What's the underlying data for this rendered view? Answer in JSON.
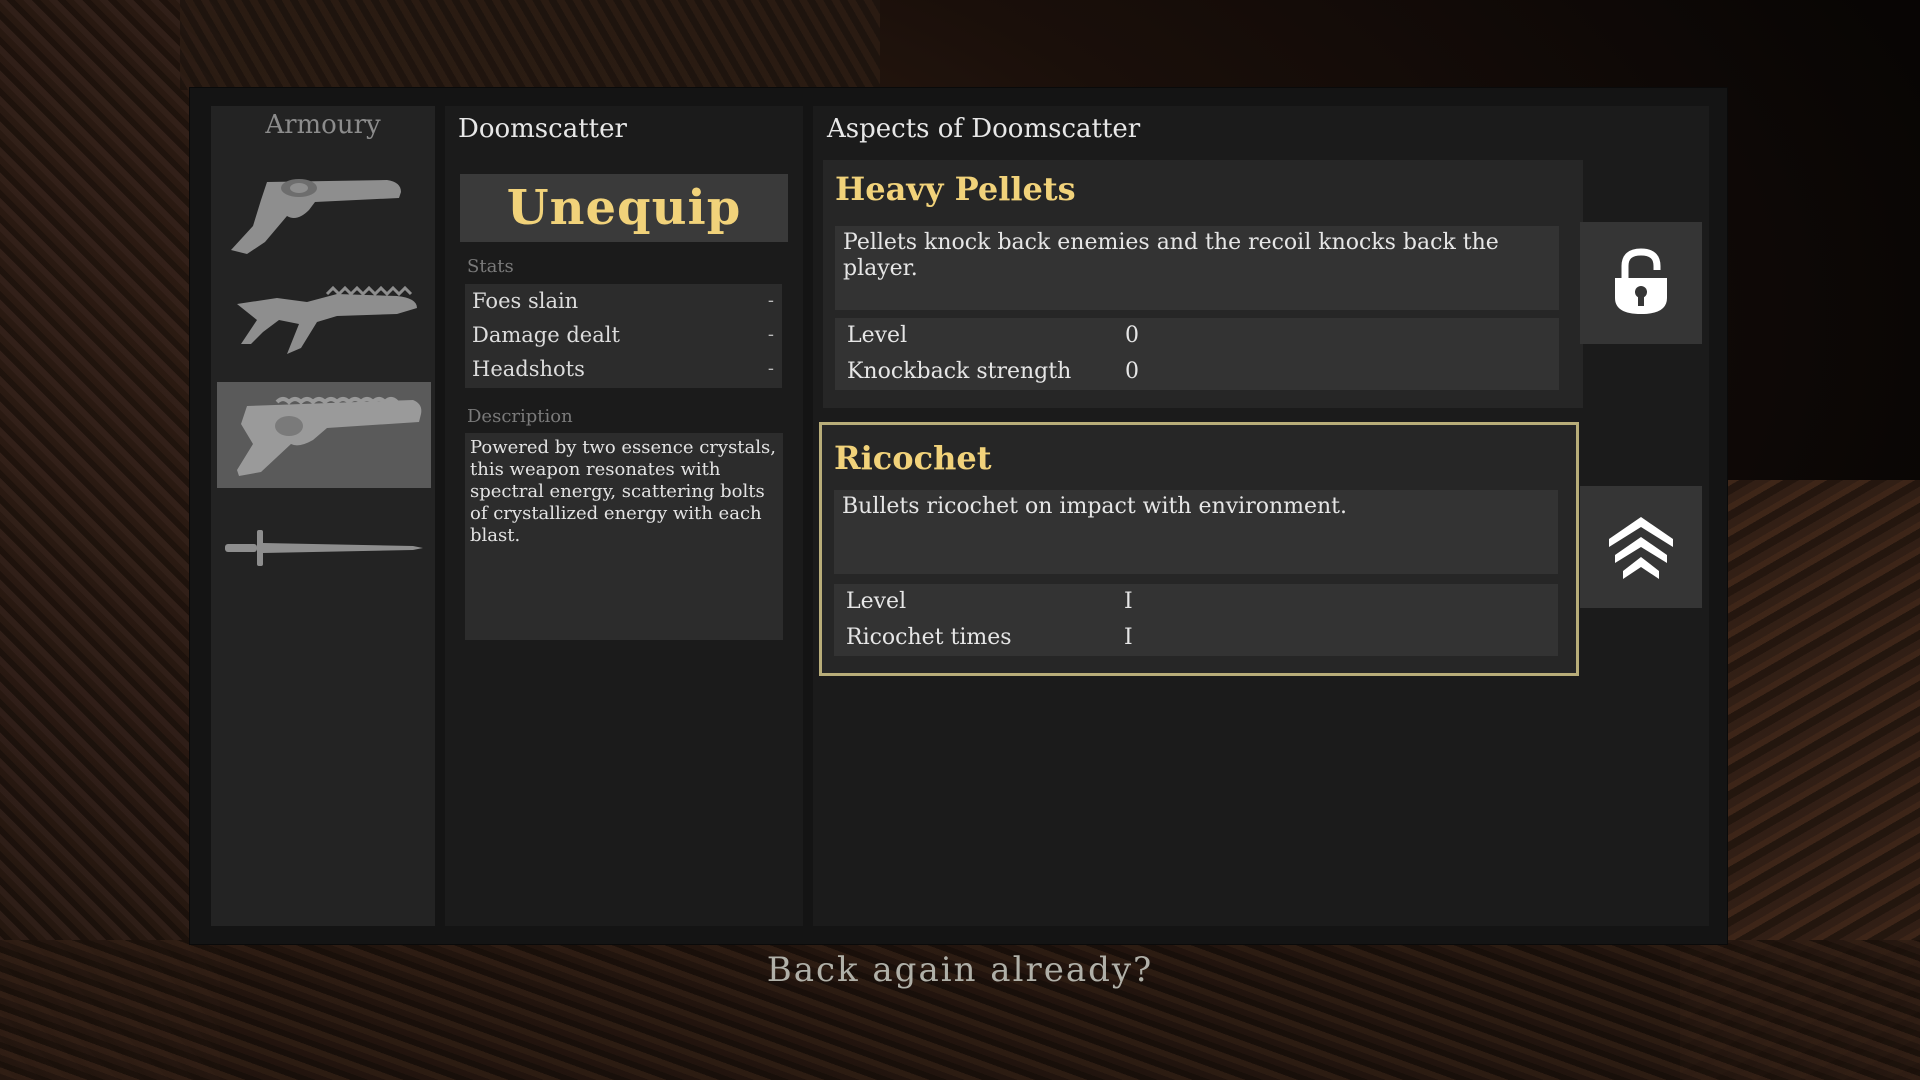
{
  "armoury": {
    "title": "Armoury",
    "weapons": [
      {
        "icon": "revolver-icon"
      },
      {
        "icon": "spiked-rifle-icon"
      },
      {
        "icon": "doomscatter-icon",
        "selected": true
      },
      {
        "icon": "sword-icon"
      }
    ]
  },
  "weapon": {
    "name": "Doomscatter",
    "unequip_label": "Unequip",
    "stats_label": "Stats",
    "stats": [
      {
        "label": "Foes slain",
        "value": "-"
      },
      {
        "label": "Damage dealt",
        "value": "-"
      },
      {
        "label": "Headshots",
        "value": "-"
      }
    ],
    "description_label": "Description",
    "description": "Powered by two essence crystals, this weapon resonates with spectral energy, scattering bolts of crystallized energy with each blast."
  },
  "aspects": {
    "title": "Aspects of Doomscatter",
    "items": [
      {
        "name": "Heavy Pellets",
        "description": "Pellets knock back enemies and the recoil knocks back the player.",
        "stats": [
          {
            "label": "Level",
            "value": "0"
          },
          {
            "label": "Knockback strength",
            "value": "0"
          }
        ],
        "action_icon": "unlock-icon"
      },
      {
        "name": "Ricochet",
        "description": "Bullets ricochet on impact with environment.",
        "stats": [
          {
            "label": "Level",
            "value": "I"
          },
          {
            "label": "Ricochet times",
            "value": "I"
          }
        ],
        "action_icon": "upgrade-chevrons-icon",
        "selected": true
      }
    ]
  },
  "dialogue": {
    "subtitle": "Back again already?"
  },
  "colors": {
    "accent_gold": "#f1d27a",
    "selected_border": "#b8ad79",
    "panel": "#1b1b1b"
  }
}
